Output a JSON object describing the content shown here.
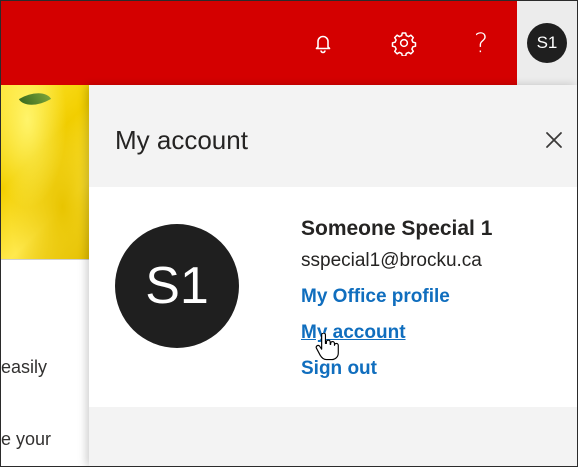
{
  "topbar": {
    "background": "#d40000",
    "icons": [
      "bell-icon",
      "gear-icon",
      "help-icon"
    ],
    "help_label": "?",
    "avatar_initials": "S1"
  },
  "background_page": {
    "text_line1": "easily",
    "text_line2": "e your"
  },
  "panel": {
    "title": "My account",
    "close_icon": "close-icon",
    "avatar_initials": "S1",
    "user_name": "Someone Special 1",
    "user_email": "sspecial1@brocku.ca",
    "links": {
      "office_profile": "My Office profile",
      "my_account": "My account",
      "sign_out": "Sign out"
    },
    "link_color": "#106ebe"
  },
  "cursor": "hand-pointer-icon"
}
